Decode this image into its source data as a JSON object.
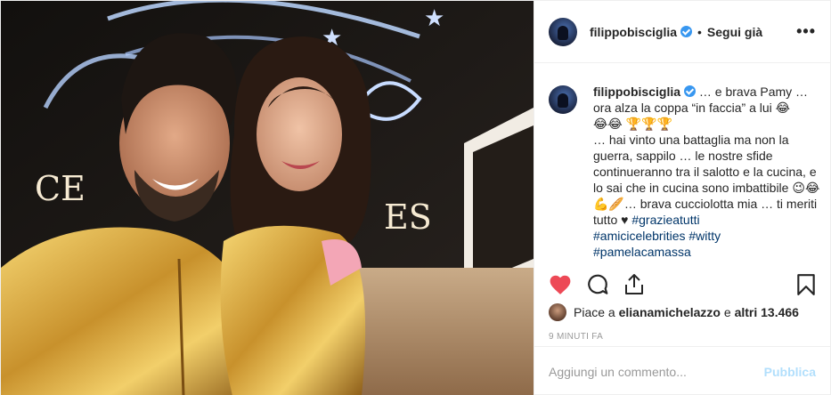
{
  "post": {
    "username": "filippobisciglia",
    "follow_status": "Segui già",
    "dot": "•",
    "more": "•••"
  },
  "caption": {
    "username": "filippobisciglia",
    "line1": "… e brava Pamy … ora alza la coppa “in faccia” a lui 😂",
    "line2": "😂😂 🏆🏆🏆",
    "line3": "… hai vinto una battaglia ma non la guerra, sappilo … le nostre sfide continueranno tra il salotto e la cucina, e lo sai che in cucina sono imbattibile 😉😂💪🥖… brava cucciolotta mia … ti meriti tutto ♥",
    "tags": [
      "#grazieatutti",
      "#amicicelebrities",
      "#witty",
      "#pamelacamassa"
    ]
  },
  "likes": {
    "prefix": "Piace a",
    "user": "elianamichelazzo",
    "connector": "e",
    "others": "altri 13.466"
  },
  "timestamp": "9 MINUTI FA",
  "comment": {
    "placeholder": "Aggiungi un commento...",
    "publish": "Pubblica"
  },
  "photo": {
    "sign_text": "CELEBRITIES",
    "sign_visible": "CE",
    "sign_tail": "ES"
  },
  "colors": {
    "heart": "#ed4956",
    "link": "#003569",
    "verified": "#3897f0",
    "publish_disabled": "#b2dffc"
  },
  "icons": {
    "heart": "heart-icon",
    "comment": "comment-icon",
    "share": "share-icon",
    "bookmark": "bookmark-icon"
  }
}
